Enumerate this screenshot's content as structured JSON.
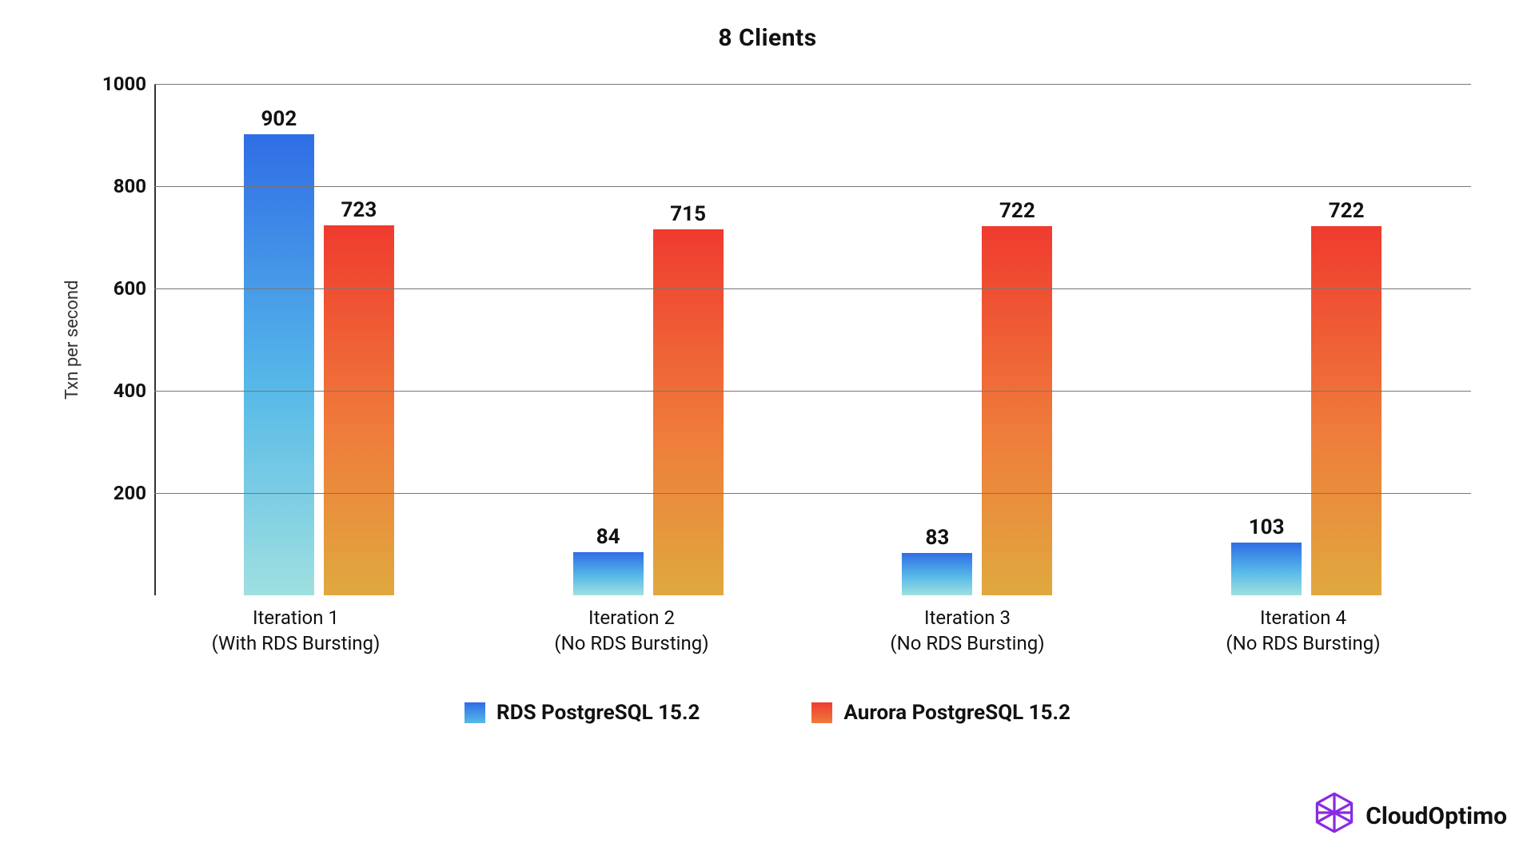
{
  "chart_data": {
    "type": "bar",
    "title": "8 Clients",
    "ylabel": "Txn per second",
    "xlabel": "",
    "ylim": [
      0,
      1000
    ],
    "yticks": [
      200,
      400,
      600,
      800,
      1000
    ],
    "categories": [
      {
        "line1": "Iteration 1",
        "line2": "(With RDS Bursting)"
      },
      {
        "line1": "Iteration 2",
        "line2": "(No RDS Bursting)"
      },
      {
        "line1": "Iteration 3",
        "line2": "(No RDS Bursting)"
      },
      {
        "line1": "Iteration 4",
        "line2": "(No RDS Bursting)"
      }
    ],
    "series": [
      {
        "name": "RDS PostgreSQL 15.2",
        "key": "rds",
        "values": [
          902,
          84,
          83,
          103
        ]
      },
      {
        "name": "Aurora PostgreSQL 15.2",
        "key": "aurora",
        "values": [
          723,
          715,
          722,
          722
        ]
      }
    ]
  },
  "legend": {
    "rds": "RDS PostgreSQL 15.2",
    "aurora": "Aurora PostgreSQL 15.2"
  },
  "brand": {
    "name": "CloudOptimo"
  }
}
